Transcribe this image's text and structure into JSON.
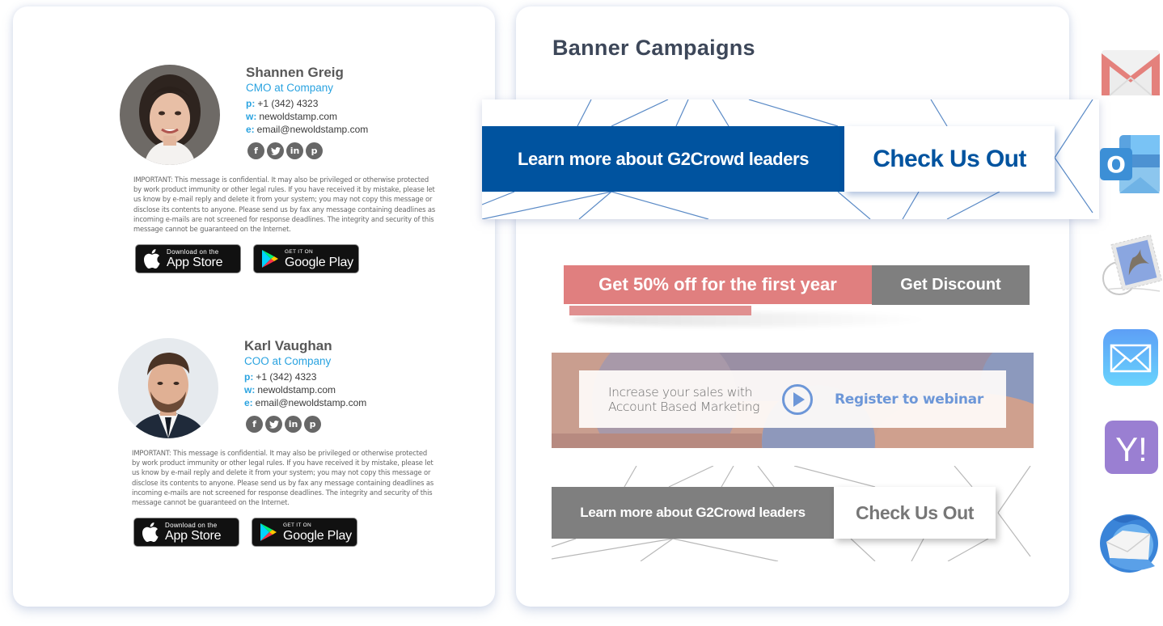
{
  "signatures": [
    {
      "name": "Shannen Greig",
      "title": "CMO at Company",
      "phone_label": "p:",
      "phone": "+1 (342) 4323",
      "web_label": "w:",
      "web": "newoldstamp.com",
      "email_label": "e:",
      "email": "email@newoldstamp.com",
      "socials": [
        "f",
        "t",
        "in",
        "p"
      ],
      "disclaimer": "IMPORTANT: This message is confidential. It may also be privileged or otherwise protected by work product immunity or other legal rules. If you have received it by mistake, please let us know by e-mail reply and delete it from your system; you may not copy this message or disclose its contents to anyone. Please send us by fax any message containing deadlines as incoming e-mails are not screened for response deadlines. The integrity and security of this message cannot be guaranteed on the Internet.",
      "app_store": {
        "small": "Download on the",
        "big": "App Store"
      },
      "google_play": {
        "small": "GET IT ON",
        "big": "Google Play"
      }
    },
    {
      "name": "Karl Vaughan",
      "title": "COO at Company",
      "phone_label": "p:",
      "phone": "+1 (342) 4323",
      "web_label": "w:",
      "web": "newoldstamp.com",
      "email_label": "e:",
      "email": "email@newoldstamp.com",
      "socials": [
        "f",
        "t",
        "in",
        "p"
      ],
      "disclaimer": "IMPORTANT: This message is confidential. It may also be privileged or otherwise protected by work product immunity or other legal rules. If you have received it by mistake, please let us know by e-mail reply and delete it from your system; you may not copy this message or disclose its contents to anyone. Please send us by fax any message containing deadlines as incoming e-mails are not screened for response deadlines. The integrity and security of this message cannot be guaranteed on the Internet.",
      "app_store": {
        "small": "Download on the",
        "big": "App Store"
      },
      "google_play": {
        "small": "GET IT ON",
        "big": "Google Play"
      }
    }
  ],
  "campaigns": {
    "title": "Banner Campaigns",
    "banners": [
      {
        "text": "Learn more about G2Crowd leaders",
        "cta": "Check Us Out",
        "color": "#00539f"
      },
      {
        "text": "Get 50% off for the first year",
        "cta": "Get Discount",
        "color": "#e07f7f"
      },
      {
        "text_line1": "Increase your sales with",
        "text_line2": "Account Based Marketing",
        "cta": "Register to webinar",
        "color": "#6d97d8"
      },
      {
        "text": "Learn more about G2Crowd leaders",
        "cta": "Check Us Out",
        "color": "#7f7f7f"
      }
    ]
  },
  "email_clients": [
    "gmail-icon",
    "outlook-icon",
    "apple-mail-icon",
    "ios-mail-icon",
    "yahoo-mail-icon",
    "thunderbird-icon"
  ],
  "yahoo_label": "Y!",
  "outlook_label": "O"
}
